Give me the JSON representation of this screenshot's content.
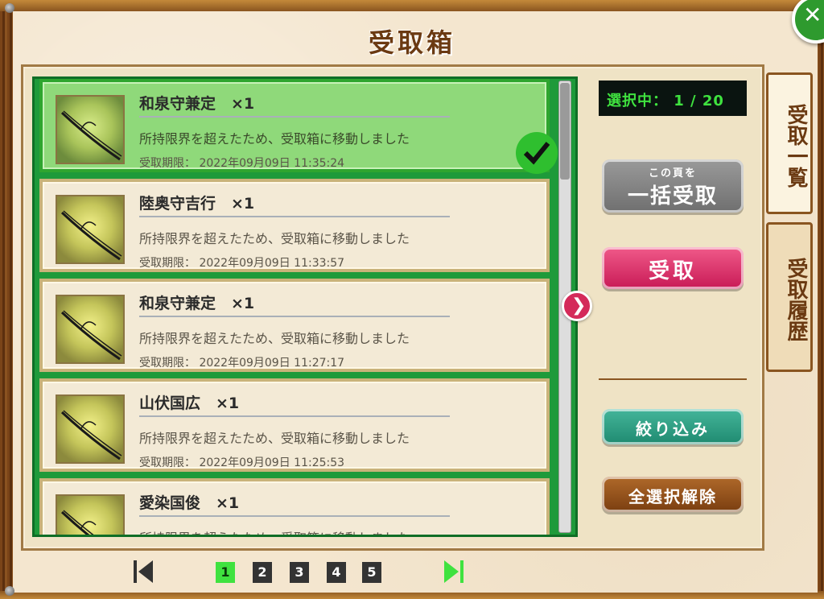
{
  "title": "受取箱",
  "close_label": "✕",
  "selection": {
    "text": "選択中： 1 / 20"
  },
  "items": [
    {
      "name": "和泉守兼定　×1",
      "message": "所持限界を超えたため、受取箱に移動しました",
      "date": "受取期限： 2022年09月09日 11:35:24",
      "selected": true
    },
    {
      "name": "陸奥守吉行　×1",
      "message": "所持限界を超えたため、受取箱に移動しました",
      "date": "受取期限： 2022年09月09日 11:33:57",
      "selected": false
    },
    {
      "name": "和泉守兼定　×1",
      "message": "所持限界を超えたため、受取箱に移動しました",
      "date": "受取期限： 2022年09月09日 11:27:17",
      "selected": false
    },
    {
      "name": "山伏国広　×1",
      "message": "所持限界を超えたため、受取箱に移動しました",
      "date": "受取期限： 2022年09月09日 11:25:53",
      "selected": false
    },
    {
      "name": "愛染国俊　×1",
      "message": "所持限界を超えたため、受取箱に移動しました",
      "date": "",
      "selected": false
    }
  ],
  "buttons": {
    "bulk_small": "この頁を",
    "bulk_large": "一括受取",
    "receive": "受取",
    "filter": "絞り込み",
    "deselect_all": "全選択解除"
  },
  "tabs": {
    "list": "受取一覧",
    "history": "受取履歴"
  },
  "pagination": {
    "pages": [
      "1",
      "2",
      "3",
      "4",
      "5"
    ],
    "current": 1
  },
  "colors": {
    "selected_item": "#8fd97a",
    "list_border": "#1e9a3a",
    "counter_text": "#3fe23f",
    "receive_button": "#d42a5a",
    "filter_button": "#1f8a70",
    "deselect_button": "#7a3e10"
  },
  "icons": {
    "close": "close-icon",
    "check": "checkmark-icon",
    "next_arrow": "chevron-right-icon",
    "first_page": "skip-first-icon",
    "last_page": "skip-last-icon",
    "item_thumbnail": "sword-icon"
  }
}
